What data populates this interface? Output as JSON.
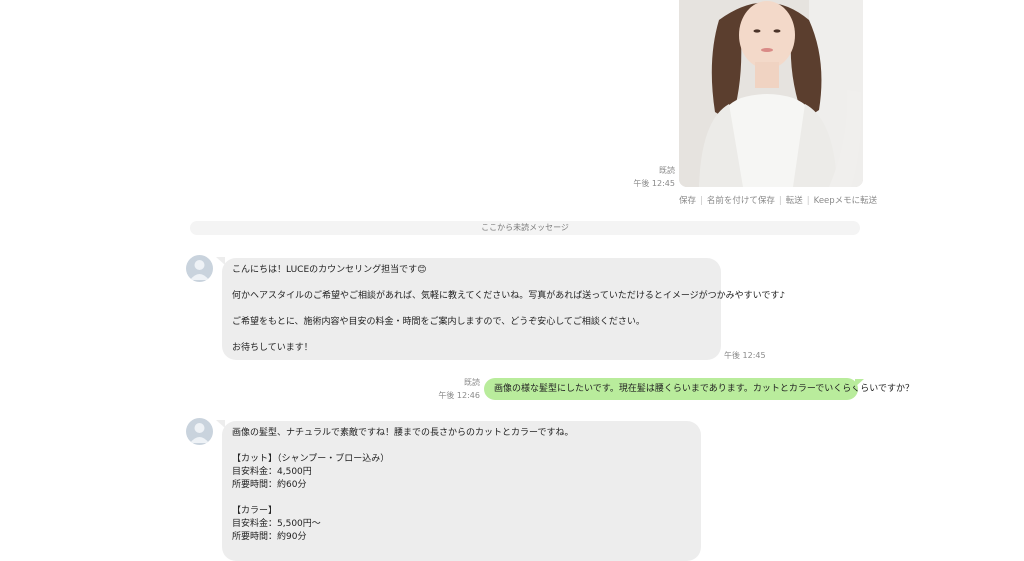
{
  "photo_message": {
    "read_label": "既読",
    "time": "午後 12:45",
    "actions": [
      "保存",
      "名前を付けて保存",
      "転送",
      "Keepメモに転送"
    ]
  },
  "unread_divider": "ここから未読メッセージ",
  "messages": [
    {
      "lines": [
        "こんにちは！LUCEのカウンセリング担当です😊",
        "",
        "何かヘアスタイルのご希望やご相談があれば、気軽に教えてくださいね。写真があれば送っていただけるとイメージがつかみやすいです♪",
        "",
        "ご希望をもとに、施術内容や目安の料金・時間をご案内しますので、どうぞ安心してご相談ください。",
        "",
        "お待ちしています！"
      ],
      "time": "午後 12:45"
    },
    {
      "text": "画像の様な髪型にしたいです。現在髪は腰くらいまであります。カットとカラーでいくらくらいですか？",
      "read_label": "既読",
      "time": "午後 12:46"
    },
    {
      "lines": [
        "画像の髪型、ナチュラルで素敵ですね！腰までの長さからのカットとカラーですね。",
        "",
        "【カット】（シャンプー・ブロー込み）",
        "目安料金：4,500円",
        "所要時間：約60分",
        "",
        "【カラー】",
        "目安料金：5,500円〜",
        "所要時間：約90分"
      ]
    }
  ]
}
